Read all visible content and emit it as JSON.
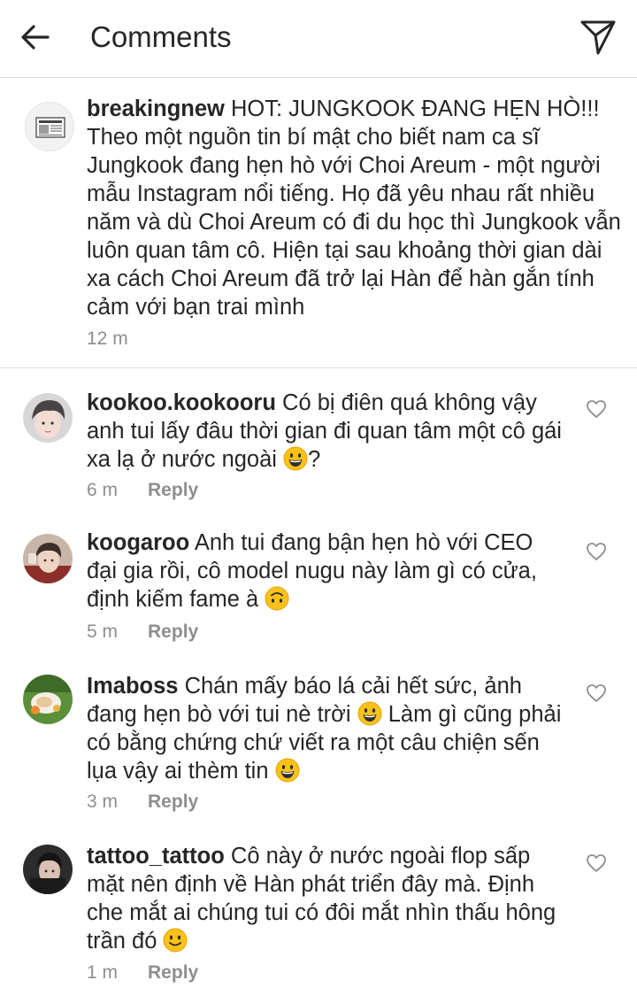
{
  "header": {
    "title": "Comments",
    "back_icon": "arrow-left-icon",
    "send_icon": "paper-plane-icon"
  },
  "caption": {
    "username": "breakingnew",
    "text": "HOT: JUNGKOOK ĐANG HẸN HÒ!!! Theo một nguồn tin bí mật cho biết nam ca sĩ Jungkook đang hẹn hò với Choi Areum - một người mẫu Instagram nổi tiếng. Họ đã yêu nhau rất nhiều năm và dù Choi Areum có đi du học thì Jungkook vẫn luôn quan tâm cô. Hiện tại sau khoảng thời gian dài xa cách Choi Areum đã trở lại Hàn để hàn gắn tính cảm với bạn trai mình",
    "time": "12 m"
  },
  "comments": [
    {
      "username": "kookoo.kookooru",
      "text": "Có bị điên quá không vậy anh tui lấy đâu thời gian đi quan tâm một cô gái xa lạ ở nước ngoài",
      "text_after": "?",
      "emoji": "grinning-face",
      "time": "6 m",
      "reply": "Reply"
    },
    {
      "username": "koogaroo",
      "text": "Anh tui đang bận hẹn hò với CEO đại gia rồi, cô model nugu này làm gì có cửa, định kiếm fame à",
      "emoji": "upside-down-face",
      "time": "5 m",
      "reply": "Reply"
    },
    {
      "username": "Imaboss",
      "text": "Chán mấy báo lá cải hết sức, ảnh đang hẹn bò với tui nè trời",
      "text_mid": "Làm gì cũng phải có bằng chứng chứ viết ra một câu chiện sến lụa vậy ai thèm tin",
      "emoji": "grinning-face",
      "time": "3 m",
      "reply": "Reply"
    },
    {
      "username": "tattoo_tattoo",
      "text": "Cô này ở nước ngoài flop sấp mặt nên định về Hàn phát triển đây mà. Định che mắt ai chúng tui có đôi mắt nhìn thấu hông trần đó",
      "emoji": "slightly-smiling-face",
      "time": "1 m",
      "reply": "Reply"
    }
  ]
}
